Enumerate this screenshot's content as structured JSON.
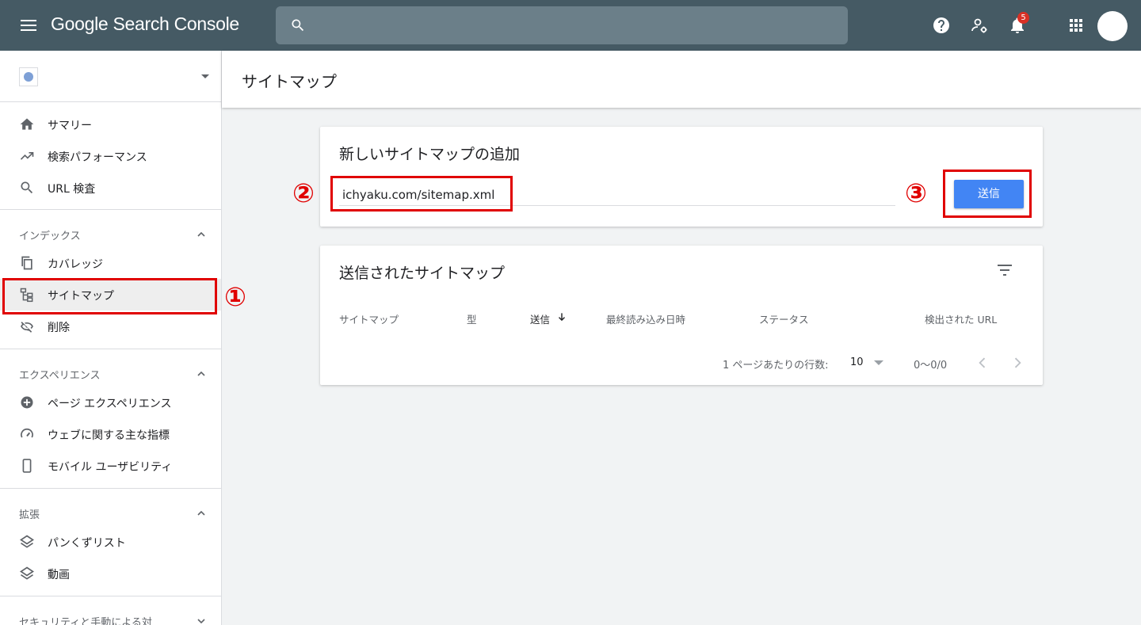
{
  "app": {
    "title": "Google Search Console",
    "notification_count": "5"
  },
  "sidebar": {
    "items_top": [
      {
        "label": "サマリー",
        "icon": "home-icon"
      },
      {
        "label": "検索パフォーマンス",
        "icon": "trending-up-icon"
      },
      {
        "label": "URL 検査",
        "icon": "search-icon"
      }
    ],
    "sections": [
      {
        "title": "インデックス",
        "items": [
          {
            "label": "カバレッジ",
            "icon": "copy-icon"
          },
          {
            "label": "サイトマップ",
            "icon": "sitemap-icon",
            "active": true
          },
          {
            "label": "削除",
            "icon": "visibility-off-icon"
          }
        ]
      },
      {
        "title": "エクスペリエンス",
        "items": [
          {
            "label": "ページ エクスペリエンス",
            "icon": "add-circle-icon"
          },
          {
            "label": "ウェブに関する主な指標",
            "icon": "speedometer-icon"
          },
          {
            "label": "モバイル ユーザビリティ",
            "icon": "smartphone-icon"
          }
        ]
      },
      {
        "title": "拡張",
        "items": [
          {
            "label": "パンくずリスト",
            "icon": "layers-icon"
          },
          {
            "label": "動画",
            "icon": "layers-icon"
          }
        ]
      },
      {
        "title": "セキュリティと手動による対"
      }
    ]
  },
  "main": {
    "page_title": "サイトマップ",
    "add_card": {
      "title": "新しいサイトマップの追加",
      "input_value": "ichyaku.com/sitemap.xml",
      "submit_label": "送信"
    },
    "submitted_card": {
      "title": "送信されたサイトマップ",
      "columns": [
        "サイトマップ",
        "型",
        "送信",
        "最終読み込み日時",
        "ステータス",
        "検出された URL"
      ],
      "sorted_column": "送信",
      "rows_per_page_label": "1 ページあたりの行数:",
      "rows_per_page_value": "10",
      "range_text": "0〜0/0"
    }
  },
  "annotations": {
    "one": "①",
    "two": "②",
    "three": "③",
    "color": "#e00000"
  }
}
